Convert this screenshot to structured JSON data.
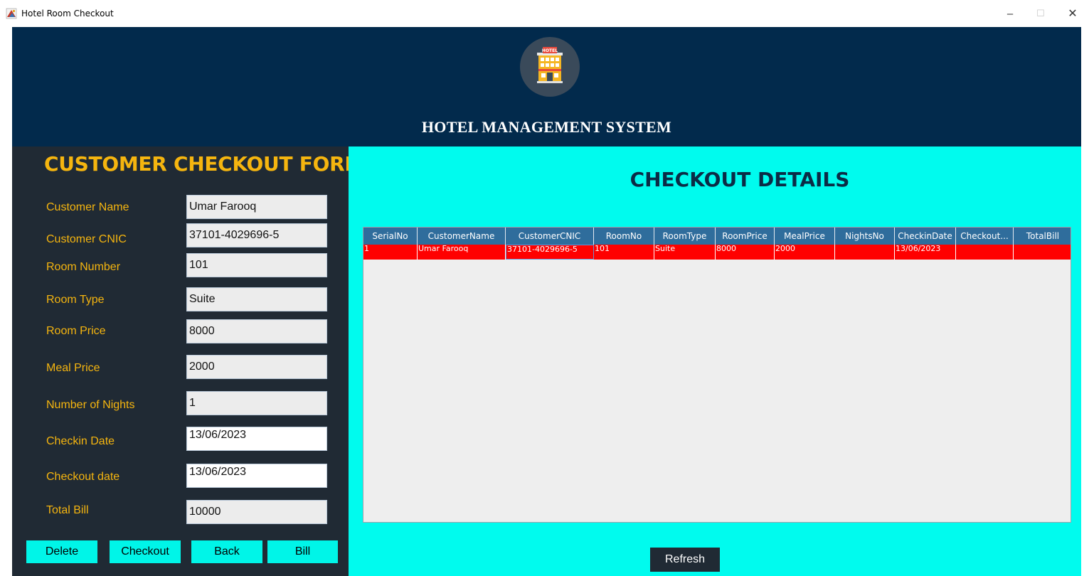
{
  "window": {
    "title": "Hotel Room Checkout",
    "minimize": "–",
    "maximize": "☐",
    "close": "✕"
  },
  "header": {
    "logo_text": "HOTEL",
    "app_title": "HOTEL MANAGEMENT SYSTEM",
    "colors": {
      "background": "#022a4c"
    }
  },
  "form": {
    "title": "CUSTOMER CHECKOUT FORM",
    "fields": [
      {
        "label": "Customer Name",
        "value": "Umar Farooq"
      },
      {
        "label": "Customer CNIC",
        "value": "37101-4029696-5"
      },
      {
        "label": "Room Number",
        "value": "101"
      },
      {
        "label": "Room Type",
        "value": "Suite"
      },
      {
        "label": "Room Price",
        "value": "8000"
      },
      {
        "label": "Meal Price",
        "value": "2000"
      },
      {
        "label": "Number of Nights",
        "value": "1"
      },
      {
        "label": "Checkin Date",
        "value": "13/06/2023"
      },
      {
        "label": "Checkout date",
        "value": "13/06/2023"
      },
      {
        "label": "Total Bill",
        "value": "10000"
      }
    ],
    "buttons": {
      "delete": "Delete",
      "checkout": "Checkout",
      "back": "Back",
      "bill": "Bill"
    },
    "colors": {
      "panel": "#202a34",
      "label": "#f5b50f",
      "button": "#00f5e8"
    }
  },
  "details": {
    "title": "CHECKOUT DETAILS",
    "columns": [
      "SerialNo",
      "CustomerName",
      "CustomerCNIC",
      "RoomNo",
      "RoomType",
      "RoomPrice",
      "MealPrice",
      "NightsNo",
      "CheckinDate",
      "Checkout...",
      "TotalBill"
    ],
    "rows": [
      [
        "1",
        "Umar Farooq",
        "37101-4029696-5",
        "101",
        "Suite",
        "8000",
        "2000",
        "",
        "13/06/2023",
        "",
        ""
      ]
    ],
    "refresh_label": "Refresh",
    "colors": {
      "panel": "#00fbee",
      "header": "#2f6d9c",
      "selected_row": "#ff0000"
    }
  }
}
